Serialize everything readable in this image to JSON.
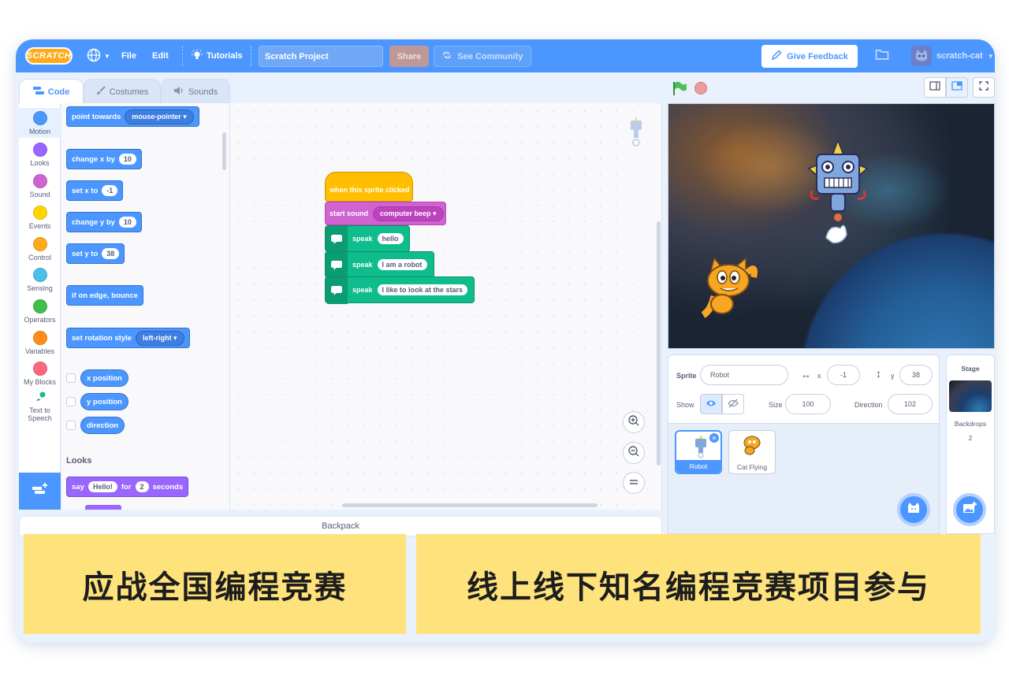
{
  "menubar": {
    "logo": "SCRATCH",
    "file": "File",
    "edit": "Edit",
    "tutorials": "Tutorials",
    "project_title": "Scratch Project",
    "share": "Share",
    "see_community": "See Community",
    "give_feedback": "Give Feedback",
    "username": "scratch-cat"
  },
  "tabs": {
    "code": "Code",
    "costumes": "Costumes",
    "sounds": "Sounds"
  },
  "categories": [
    {
      "label": "Motion",
      "color": "#4c97ff"
    },
    {
      "label": "Looks",
      "color": "#9966ff"
    },
    {
      "label": "Sound",
      "color": "#cf63cf"
    },
    {
      "label": "Events",
      "color": "#ffd500"
    },
    {
      "label": "Control",
      "color": "#ffab19"
    },
    {
      "label": "Sensing",
      "color": "#4cbfe6"
    },
    {
      "label": "Operators",
      "color": "#40bf4a"
    },
    {
      "label": "Variables",
      "color": "#ff8c1a"
    },
    {
      "label": "My Blocks",
      "color": "#ff6680"
    },
    {
      "label": "Text to Speech",
      "color": "#0fbd8c"
    }
  ],
  "palette": {
    "point_towards": "point towards",
    "point_towards_value": "mouse-pointer",
    "change_x": "change x by",
    "change_x_value": "10",
    "set_x": "set x to",
    "set_x_value": "-1",
    "change_y": "change y by",
    "change_y_value": "10",
    "set_y": "set y to",
    "set_y_value": "38",
    "bounce": "if on edge, bounce",
    "rotation_style": "set rotation style",
    "rotation_style_value": "left-right",
    "x_position": "x position",
    "y_position": "y position",
    "direction": "direction",
    "looks_heading": "Looks",
    "say": "say",
    "say_value": "Hello!",
    "say_for": "for",
    "say_secs_value": "2",
    "say_seconds": "seconds"
  },
  "script": {
    "hat": "when this sprite clicked",
    "start_sound": "start sound",
    "sound_value": "computer beep",
    "speak": "speak",
    "speak1": "hello",
    "speak2": "I am a robot",
    "speak3": "I like to look at the stars"
  },
  "backpack": "Backpack",
  "sprite_info": {
    "sprite_label": "Sprite",
    "sprite_name": "Robot",
    "x_label": "x",
    "x_value": "-1",
    "y_label": "y",
    "y_value": "38",
    "show_label": "Show",
    "size_label": "Size",
    "size_value": "100",
    "direction_label": "Direction",
    "direction_value": "102"
  },
  "sprites": [
    {
      "name": "Robot",
      "selected": true
    },
    {
      "name": "Cat Flying",
      "selected": false
    }
  ],
  "stage_pane": {
    "title": "Stage",
    "backdrops_label": "Backdrops",
    "backdrops_count": "2"
  },
  "banners": {
    "left": "应战全国编程竞赛",
    "right": "线上线下知名编程竞赛项目参与"
  }
}
